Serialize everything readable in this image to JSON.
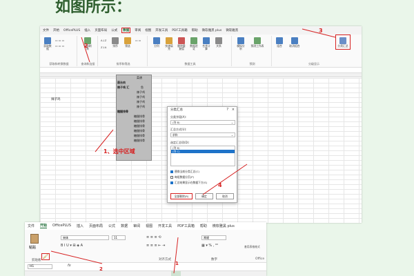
{
  "heading": "如图所示：",
  "top": {
    "menu": [
      "文件",
      "开始",
      "OfficePLUS",
      "插入",
      "页面布局",
      "公式",
      "数据",
      "审阅",
      "视图",
      "开发工具",
      "PDF工具箱",
      "帮助",
      "微软雅黑 plus",
      "微软雅黑"
    ],
    "active_menu": "数据",
    "ribbon_buttons": [
      "获取数据",
      "全部刷新",
      "排序",
      "筛选",
      "分列",
      "快速填充",
      "删除重复值",
      "数据验证",
      "合并计算",
      "关系",
      "模拟分析",
      "预测工作表",
      "组合",
      "取消组合",
      "分类汇总"
    ],
    "group_labels": [
      "获取和转换数据",
      "查询和连接",
      "排序和筛选",
      "数据工具",
      "预测",
      "分级显示"
    ],
    "cell_a": "辣子鸡",
    "sel_cells": [
      {
        "t": "菜谱",
        "b": false
      },
      {
        "t": "蒜台肉",
        "b": true
      },
      {
        "t": "鱼",
        "b": false
      },
      {
        "t": "辣子鸡 汇",
        "b": true
      },
      {
        "t": "",
        "b": false
      },
      {
        "t": "辣子鸡",
        "b": false
      },
      {
        "t": "辣子鸡",
        "b": false
      },
      {
        "t": "辣子鸡",
        "b": false
      },
      {
        "t": "辣子鸡",
        "b": false
      },
      {
        "t": "糖醋排骨",
        "b": true
      },
      {
        "t": "糖醋排骨",
        "b": false
      },
      {
        "t": "糖醋排骨",
        "b": false
      },
      {
        "t": "糖醋排骨",
        "b": false
      },
      {
        "t": "糖醋排骨",
        "b": false
      },
      {
        "t": "糖醋排骨",
        "b": false
      },
      {
        "t": "糖醋排骨",
        "b": false
      }
    ],
    "dialog": {
      "title": "分类汇总",
      "help": "?",
      "close": "×",
      "label_field": "分类字段(A):",
      "field_value": "(列 B)",
      "label_func": "汇总方式(U):",
      "func_value": "求和",
      "label_items": "选定汇总项(D):",
      "items": [
        "(列 B)",
        "(列 C)"
      ],
      "checks": [
        {
          "label": "替换当前分类汇总(C)",
          "on": true
        },
        {
          "label": "每组数据分页(P)",
          "on": false
        },
        {
          "label": "汇总结果显示在数据下方(S)",
          "on": true
        }
      ],
      "btn_remove": "全部删除(R)",
      "btn_ok": "确定",
      "btn_cancel": "取消"
    },
    "annotations": {
      "step1": "1、选中区域",
      "n2": "2",
      "n3": "3",
      "n4": "4"
    }
  },
  "bottom": {
    "menu": [
      "文件",
      "开始",
      "OfficePLUS",
      "插入",
      "页面布局",
      "公式",
      "数据",
      "审阅",
      "视图",
      "开发工具",
      "PDF工具箱",
      "帮助",
      "微软雅黑 plus"
    ],
    "active_menu": "开始",
    "paste": "粘贴",
    "clipboard": "剪贴板",
    "font_name": "宋体",
    "font_size": "11",
    "number_format": "常规",
    "align_group": "对齐方式",
    "number_group": "数字",
    "styles": "套用表格格式",
    "office": "Office",
    "name_box": "H1",
    "fx": "fx",
    "brush": "🖌",
    "ann1": "1",
    "ann2": "2"
  }
}
